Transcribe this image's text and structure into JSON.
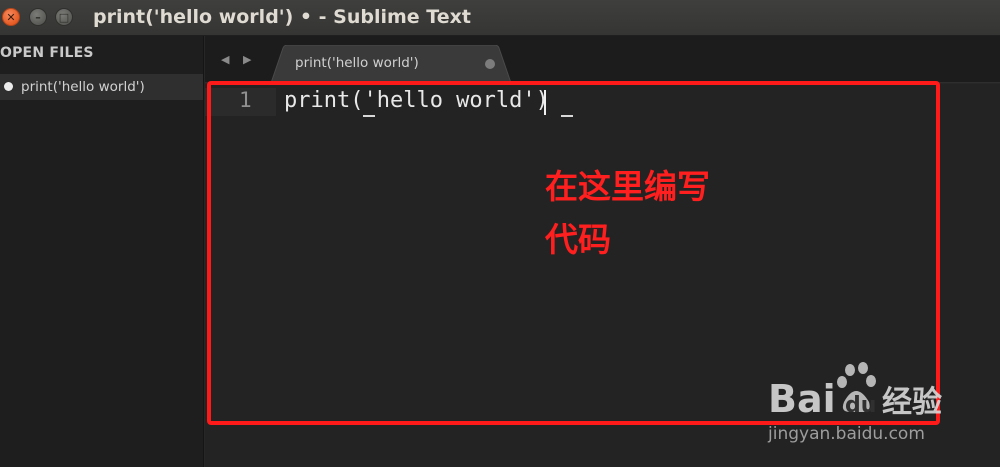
{
  "window": {
    "title": "print('hello world') • - Sublime Text",
    "close_glyph": "✕",
    "minimize_glyph": "–",
    "maximize_glyph": "□"
  },
  "sidebar": {
    "heading": "OPEN FILES",
    "files": [
      {
        "label": "print('hello world')",
        "modified": true
      }
    ]
  },
  "tabs": {
    "nav_left_glyph": "◀",
    "nav_right_glyph": "▶",
    "items": [
      {
        "label": "print('hello world')",
        "modified": true,
        "active": true
      }
    ]
  },
  "editor": {
    "lines": [
      {
        "number": "1",
        "text": "print('hello world')"
      }
    ]
  },
  "annotation": {
    "line1": "在这里编写",
    "line2": "代码",
    "color": "#ff1a1a"
  },
  "watermark": {
    "logo_text": "Bai du 经验",
    "url": "jingyan.baidu.com"
  },
  "colors": {
    "accent_close": "#e55b23",
    "editor_bg": "#232323",
    "sidebar_bg": "#1e1e1e"
  }
}
